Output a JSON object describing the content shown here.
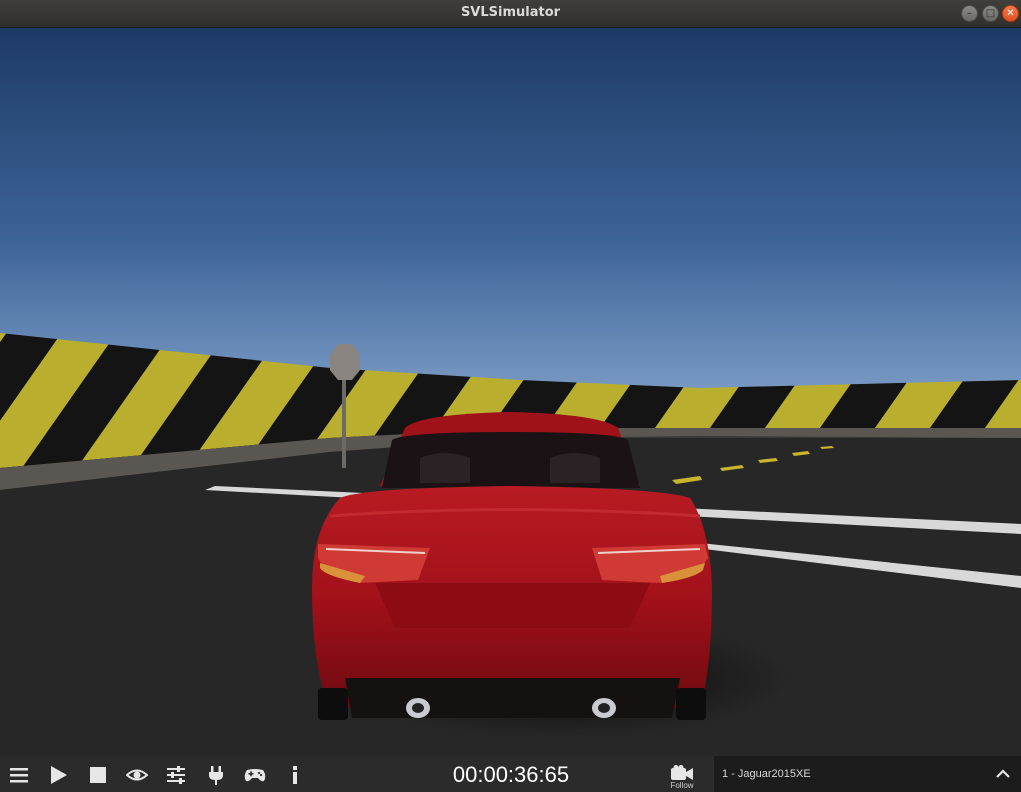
{
  "window": {
    "title": "SVLSimulator",
    "controls": [
      "minimize",
      "maximize",
      "close"
    ]
  },
  "toolbar": {
    "buttons": [
      {
        "name": "menu-icon"
      },
      {
        "name": "play-icon"
      },
      {
        "name": "stop-icon"
      },
      {
        "name": "eye-icon"
      },
      {
        "name": "sliders-icon"
      },
      {
        "name": "plug-icon"
      },
      {
        "name": "gamepad-icon"
      },
      {
        "name": "info-icon"
      }
    ],
    "timer": "00:00:36:65",
    "camera": {
      "icon": "video-camera-icon",
      "label": "Follow"
    },
    "agent_selector": {
      "label": "1 - Jaguar2015XE",
      "icon": "chevron-up-icon"
    }
  },
  "scene": {
    "description_colors": {
      "sky_top": "#1f3c67",
      "sky_bottom": "#6f95c4",
      "barrier_yellow": "#b8ad2a",
      "barrier_black": "#151515",
      "car_red": "#9e0d14",
      "road": "#262626"
    }
  }
}
